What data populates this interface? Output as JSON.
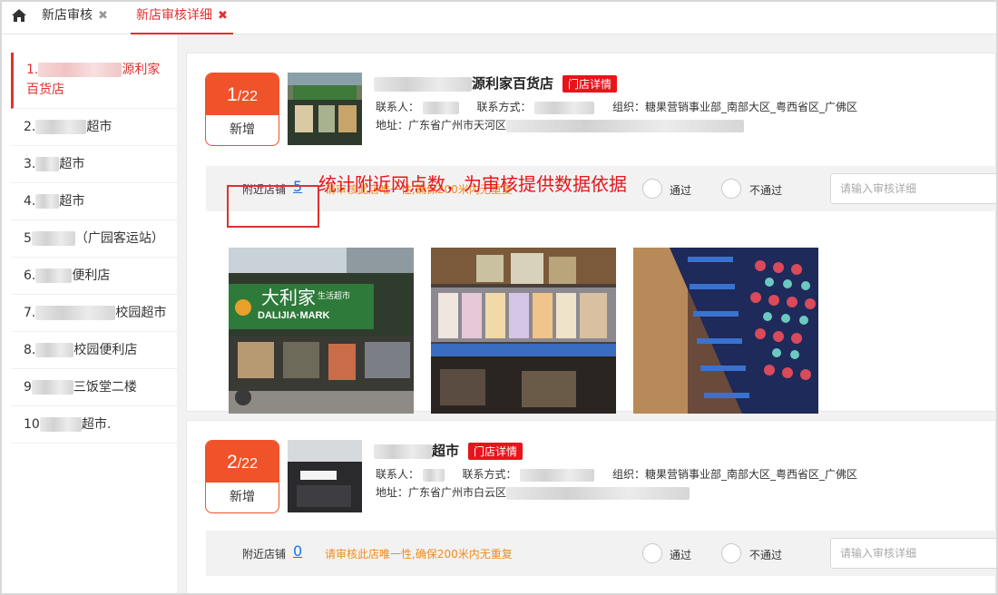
{
  "tabs": [
    {
      "label": "新店审核",
      "close": "✖"
    },
    {
      "label": "新店审核详细",
      "close": "✖"
    }
  ],
  "sidebar": {
    "items": [
      {
        "prefix": "1.",
        "suffix": "源利家百货店"
      },
      {
        "prefix": "2.",
        "suffix": "超市"
      },
      {
        "prefix": "3.",
        "suffix": "超市"
      },
      {
        "prefix": "4.",
        "suffix": "超市"
      },
      {
        "prefix": "5",
        "suffix": "（广园客运站）"
      },
      {
        "prefix": "6.",
        "suffix": "便利店"
      },
      {
        "prefix": "7.",
        "suffix": "校园超市"
      },
      {
        "prefix": "8.",
        "suffix": "校园便利店"
      },
      {
        "prefix": "9",
        "suffix": "三饭堂二楼"
      },
      {
        "prefix": "10",
        "suffix": "超市."
      }
    ]
  },
  "annotation": "统计附近网点数，为审核提供数据依据",
  "cards": [
    {
      "index": "1",
      "total": "/22",
      "status": "新增",
      "name_suffix": "源利家百货店",
      "detail_button": "门店详情",
      "contact_label": "联系人：",
      "phone_label": "联系方式：",
      "org_label": "组织：",
      "org": "糖果营销事业部_南部大区_粤西省区_广佛区",
      "address_label": "地址：",
      "address": "广东省广州市天河区",
      "nearby_label": "附近店铺",
      "nearby_count": "5",
      "hint": "请审核此店唯一性,确保200米内无重复",
      "pass_label": "通过",
      "fail_label": "不通过",
      "input_placeholder": "请输入审核详细"
    },
    {
      "index": "2",
      "total": "/22",
      "status": "新增",
      "name_suffix": "超市",
      "detail_button": "门店详情",
      "contact_label": "联系人：",
      "phone_label": "联系方式：",
      "org_label": "组织：",
      "org": "糖果营销事业部_南部大区_粤西省区_广佛区",
      "address_label": "地址：",
      "address": "广东省广州市白云区",
      "nearby_label": "附近店铺",
      "nearby_count": "0",
      "hint": "请审核此店唯一性,确保200米内无重复",
      "pass_label": "通过",
      "fail_label": "不通过",
      "input_placeholder": "请输入审核详细"
    }
  ],
  "store_sign": {
    "brand": "大利家",
    "sub": "生活超市",
    "latin": "DALIJIA·MARK"
  },
  "colors": {
    "accent": "#e03030",
    "badge": "#f0522a",
    "link": "#1a73e8",
    "hint": "#f08c1a"
  }
}
